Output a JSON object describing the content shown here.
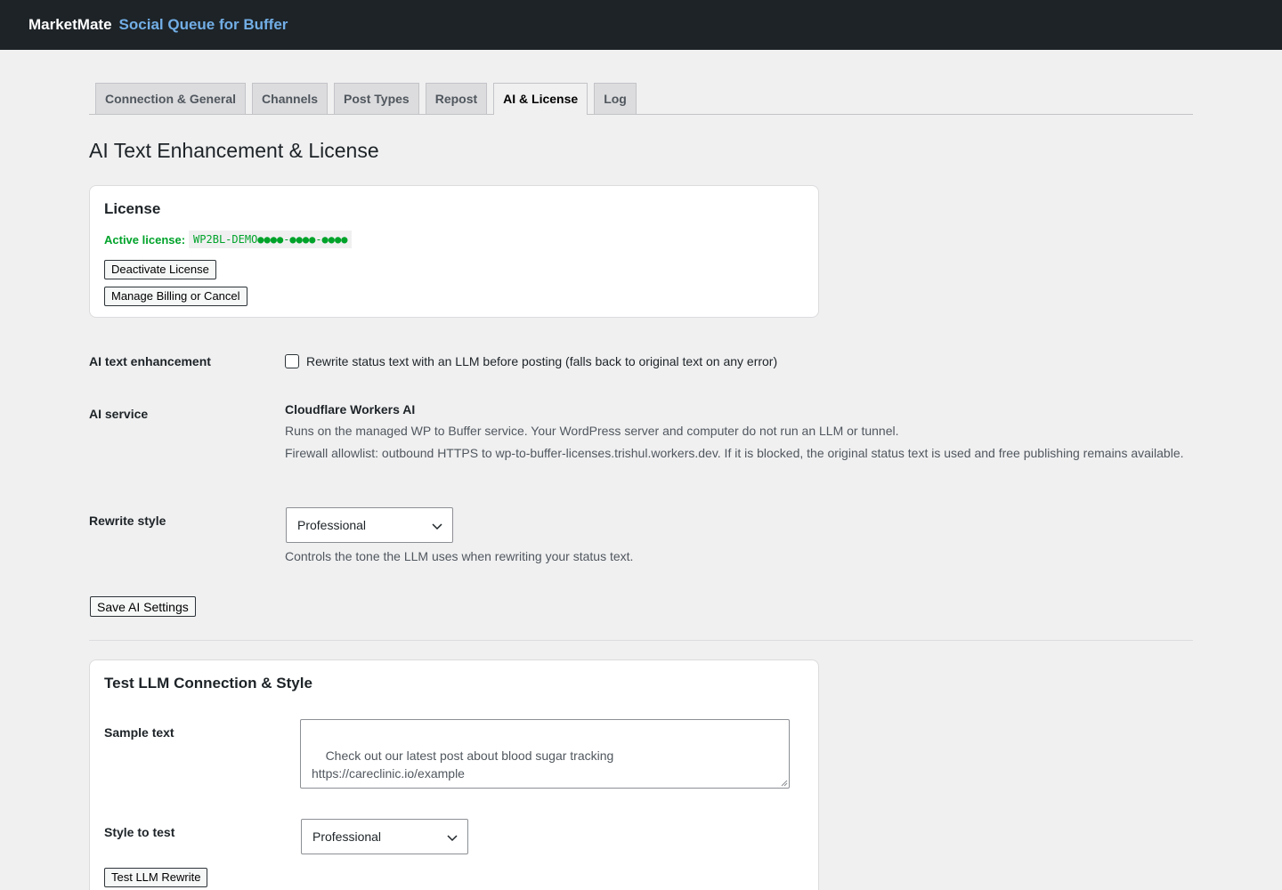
{
  "header": {
    "brand": "MarketMate",
    "product": "Social Queue for Buffer"
  },
  "tabs": [
    {
      "label": "Connection & General",
      "active": false
    },
    {
      "label": "Channels",
      "active": false
    },
    {
      "label": "Post Types",
      "active": false
    },
    {
      "label": "Repost",
      "active": false
    },
    {
      "label": "AI & License",
      "active": true
    },
    {
      "label": "Log",
      "active": false
    }
  ],
  "page_title": "AI Text Enhancement & License",
  "license": {
    "title": "License",
    "active_label": "Active license:",
    "key": "WP2BL-DEMO●●●●-●●●●-●●●●",
    "deactivate_button": "Deactivate License",
    "billing_button": "Manage Billing or Cancel"
  },
  "ai_enhancement": {
    "label": "AI text enhancement",
    "checkbox_label": "Rewrite status text with an LLM before posting (falls back to original text on any error)",
    "checked": false
  },
  "ai_service": {
    "label": "AI service",
    "name": "Cloudflare Workers AI",
    "description": "Runs on the managed WP to Buffer service. Your WordPress server and computer do not run an LLM or tunnel.",
    "firewall_note": "Firewall allowlist: outbound HTTPS to wp-to-buffer-licenses.trishul.workers.dev. If it is blocked, the original status text is used and free publishing remains available."
  },
  "rewrite_style": {
    "label": "Rewrite style",
    "selected": "Professional",
    "help": "Controls the tone the LLM uses when rewriting your status text."
  },
  "save_button": "Save AI Settings",
  "test": {
    "title": "Test LLM Connection & Style",
    "sample_label": "Sample text",
    "sample_value": "Check out our latest post about blood sugar tracking\nhttps://careclinic.io/example",
    "style_label": "Style to test",
    "style_selected": "Professional",
    "test_button": "Test LLM Rewrite"
  },
  "colors": {
    "topbar": "#1d2327",
    "product_accent": "#72aee6",
    "active_license": "#00a32a",
    "background": "#f0f0f1"
  }
}
